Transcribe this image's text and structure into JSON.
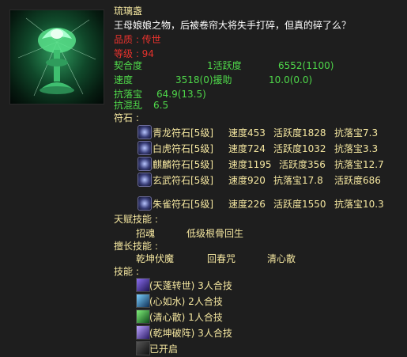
{
  "item": {
    "name": "琉璃盏",
    "description": "王母娘娘之物，后被卷帘大将失手打碎，但真的碎了么？",
    "quality": "品质 : 传世",
    "level": "等级 : 94"
  },
  "stats": {
    "row1": {
      "label": "契合度",
      "mid": "1活跃度",
      "value": "6552(1100)"
    },
    "row2": {
      "label": "速度",
      "mid": "3518(0)援助",
      "value": "10.0(0.0)"
    },
    "row3": {
      "label": "抗落宝",
      "value": "64.9(13.5)"
    },
    "row4": {
      "label": "抗混乱",
      "value": "6.5"
    }
  },
  "runes": {
    "heading": "符石 :",
    "items": [
      {
        "icon": "azure-dragon-rune-icon",
        "name": "青龙符石[5级]",
        "a": "速度453",
        "b": "活跃度1828",
        "c": "抗落宝7.3"
      },
      {
        "icon": "white-tiger-rune-icon",
        "name": "白虎符石[5级]",
        "a": "速度724",
        "b": "活跃度1032",
        "c": "抗落宝3.3"
      },
      {
        "icon": "qilin-rune-icon",
        "name": "麒麟符石[5级]",
        "a": "速度1195",
        "b": "活跃度356",
        "c": "抗落宝12.7"
      },
      {
        "icon": "black-tortoise-rune-icon",
        "name": "玄武符石[5级]",
        "a": "速度920",
        "b": "抗落宝17.8",
        "c": "活跃度686"
      },
      {
        "icon": "vermilion-bird-rune-icon",
        "name": "朱雀符石[5级]",
        "a": "速度226",
        "b": "活跃度1550",
        "c": "抗落宝10.3"
      }
    ]
  },
  "talent": {
    "heading": "天赋技能 :",
    "skill1": "招魂",
    "skill2": "低级根骨回生"
  },
  "specialty": {
    "heading": "擅长技能 :",
    "skill1": "乾坤伏魔",
    "skill2": "回春咒",
    "skill3": "清心散"
  },
  "skills": {
    "heading": "技能 :",
    "items": [
      {
        "icon": "tianpeng-skill-icon",
        "text": "(天蓬转世) 3人合技"
      },
      {
        "icon": "xinrushui-skill-icon",
        "text": "(心如水) 2人合技"
      },
      {
        "icon": "qingxinsan-skill-icon",
        "text": "(清心散) 1人合技"
      },
      {
        "icon": "qiankunpozhen-skill-icon",
        "text": "(乾坤破阵) 3人合技"
      },
      {
        "icon": "enabled-marker-icon",
        "text": "已开启"
      }
    ]
  },
  "colors": {
    "name": "#f5e7a0",
    "quality": "#e8322d",
    "stat": "#4fd94a",
    "heading": "#f5e7a0",
    "body": "#ffffff",
    "background": "#1e1e1e"
  }
}
